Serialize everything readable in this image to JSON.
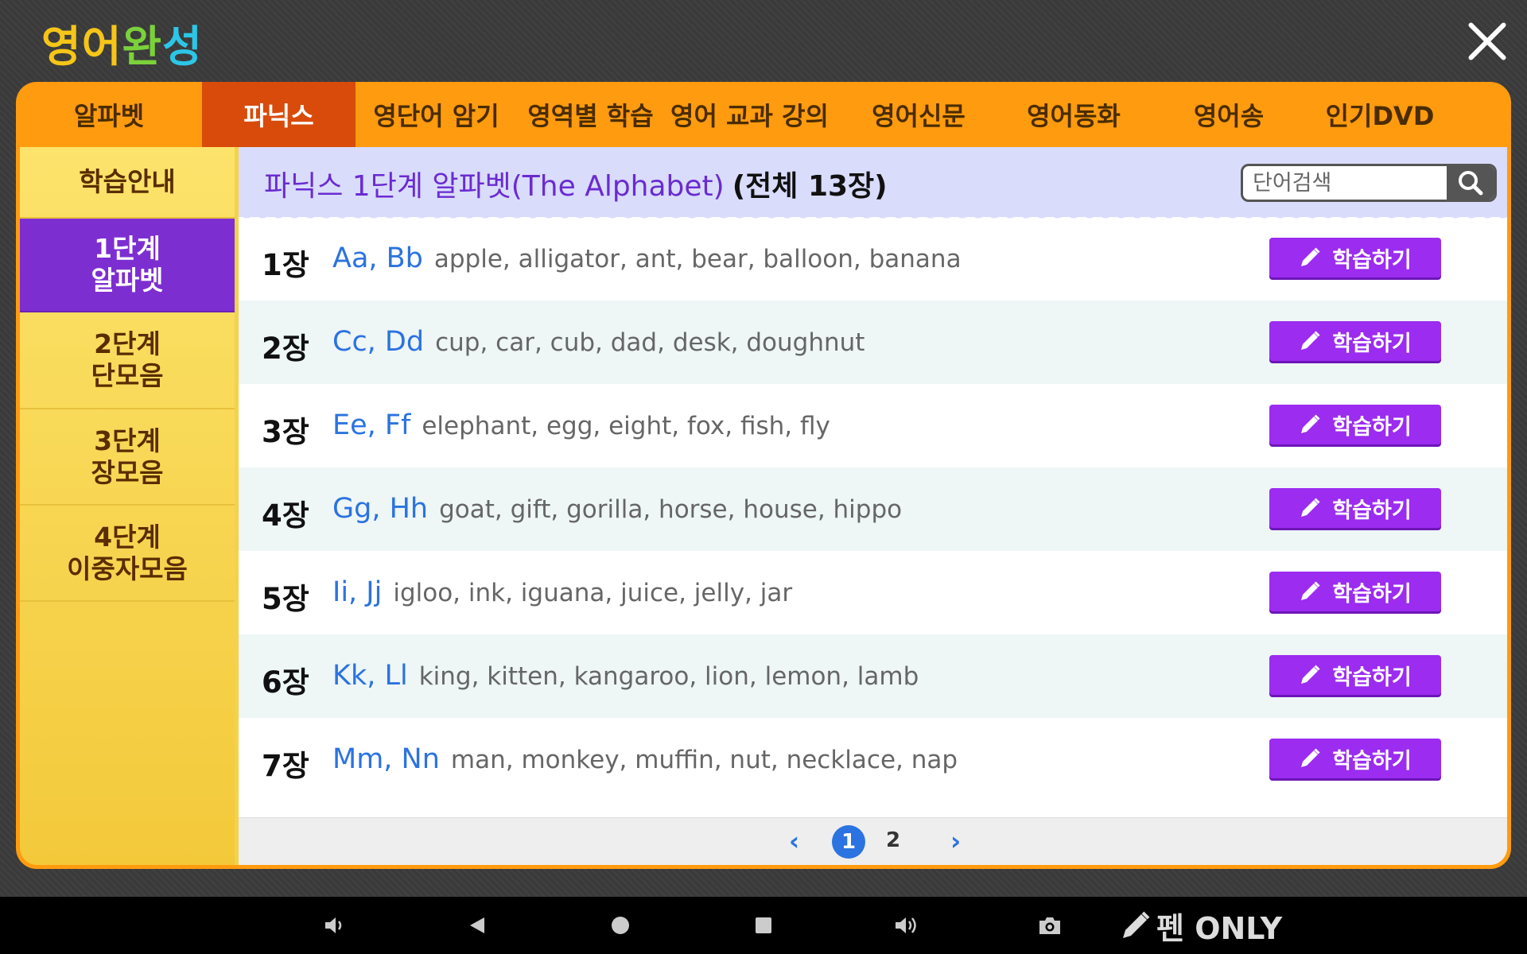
{
  "app": {
    "logo_chars": [
      "영",
      "어",
      "완",
      "성"
    ],
    "colors": {
      "frame": "#ff9b0f",
      "active_tab": "#d94b0a",
      "active_side": "#7d2ed1",
      "sidebar": "#f5d24a",
      "accent_blue": "#2b73e0",
      "study_button": "#9b2cf0"
    }
  },
  "topnav": {
    "tabs": [
      "알파벳",
      "파닉스",
      "영단어 암기",
      "영역별 학습",
      "영어 교과 강의",
      "영어신문",
      "영어동화",
      "영어송",
      "인기DVD"
    ],
    "active_index": 1
  },
  "sidebar": {
    "items": [
      {
        "line1": "학습안내",
        "line2": ""
      },
      {
        "line1": "1단계",
        "line2": "알파벳"
      },
      {
        "line1": "2단계",
        "line2": "단모음"
      },
      {
        "line1": "3단계",
        "line2": "장모음"
      },
      {
        "line1": "4단계",
        "line2": "이중자모음"
      }
    ],
    "active_index": 1
  },
  "main": {
    "title": "파닉스 1단계 알파벳(The Alphabet)",
    "count": "(전체 13장)",
    "search_placeholder": "단어검색",
    "study_label": "학습하기",
    "rows": [
      {
        "num": "1장",
        "letters": "Aa, Bb",
        "words": "apple, alligator, ant, bear, balloon, banana"
      },
      {
        "num": "2장",
        "letters": "Cc, Dd",
        "words": "cup, car, cub, dad, desk, doughnut"
      },
      {
        "num": "3장",
        "letters": "Ee, Ff",
        "words": "elephant, egg, eight, fox, fish, fly"
      },
      {
        "num": "4장",
        "letters": "Gg, Hh",
        "words": "goat, gift, gorilla, horse, house, hippo"
      },
      {
        "num": "5장",
        "letters": "Ii, Jj",
        "words": "igloo, ink, iguana, juice, jelly, jar"
      },
      {
        "num": "6장",
        "letters": "Kk, Ll",
        "words": "king, kitten, kangaroo, lion, lemon, lamb"
      },
      {
        "num": "7장",
        "letters": "Mm, Nn",
        "words": "man, monkey, muffin, nut, necklace, nap"
      }
    ]
  },
  "pager": {
    "prev": "‹",
    "next": "›",
    "pages": [
      "1",
      "2"
    ],
    "current": "1"
  },
  "sysbar": {
    "icons": [
      "volume-down-icon",
      "back-icon",
      "home-icon",
      "recents-icon",
      "volume-up-icon",
      "camera-icon"
    ],
    "pen_only_label": "펜 ONLY"
  }
}
